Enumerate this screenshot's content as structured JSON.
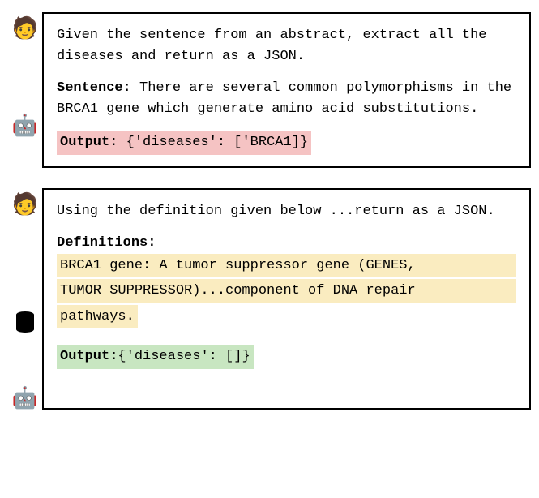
{
  "block1": {
    "prompt": "Given the sentence from an abstract, extract all the diseases and return as a JSON.",
    "sentence_label": "Sentence",
    "sentence_text": ": There are several common polymorphisms in the BRCA1 gene which generate amino acid substitutions.",
    "output_label": "Output",
    "output_text": ": {'diseases': ['BRCA1]}"
  },
  "block2": {
    "prompt": "Using the definition given below ...return as a JSON.",
    "defs_label": "Definitions:",
    "def_line1": "BRCA1 gene: A tumor suppressor gene (GENES,",
    "def_line2": "TUMOR SUPPRESSOR)...component of DNA repair",
    "def_line3": "pathways.",
    "output_label": "Output:",
    "output_text": "{'diseases': []}"
  },
  "icons": {
    "person": "🧑",
    "robot": "🤖",
    "database": "database-icon"
  }
}
